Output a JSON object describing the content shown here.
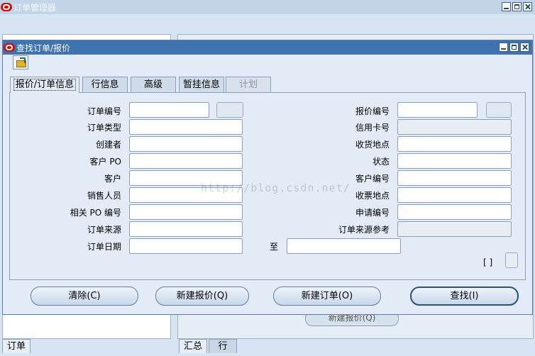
{
  "outer": {
    "title": "订单管理器"
  },
  "background": {
    "left_tab": "订单",
    "right_tabs": [
      "汇总",
      "行"
    ],
    "behind_button": "新建报价(Q)"
  },
  "dialog": {
    "title": "查找订单/报价",
    "tabs": [
      {
        "label": "报价/订单信息",
        "active": true
      },
      {
        "label": "行信息"
      },
      {
        "label": "高级"
      },
      {
        "label": "暂挂信息"
      },
      {
        "label": "计划",
        "disabled": true
      }
    ],
    "left_fields": [
      {
        "label": "订单编号",
        "value": ""
      },
      {
        "label": "订单类型",
        "value": ""
      },
      {
        "label": "创建者",
        "value": ""
      },
      {
        "label": "客户 PO",
        "value": ""
      },
      {
        "label": "客户",
        "value": ""
      },
      {
        "label": "销售人员",
        "value": ""
      },
      {
        "label": "相关 PO 编号",
        "value": ""
      },
      {
        "label": "订单来源",
        "value": ""
      },
      {
        "label": "订单日期",
        "value": ""
      }
    ],
    "to_label": "至",
    "right_fields": [
      {
        "label": "报价编号",
        "value": ""
      },
      {
        "label": "信用卡号",
        "value": ""
      },
      {
        "label": "收货地点",
        "value": ""
      },
      {
        "label": "状态",
        "value": ""
      },
      {
        "label": "客户编号",
        "value": ""
      },
      {
        "label": "收票地点",
        "value": ""
      },
      {
        "label": "申请编号",
        "value": ""
      },
      {
        "label": "订单来源参考",
        "value": ""
      }
    ],
    "bracket": "[ ]",
    "buttons": {
      "clear": "清除(C)",
      "new_quote": "新建报价(Q)",
      "new_order": "新建订单(O)",
      "find": "查找(I)"
    }
  },
  "watermark": "http://blog.csdn.net/"
}
